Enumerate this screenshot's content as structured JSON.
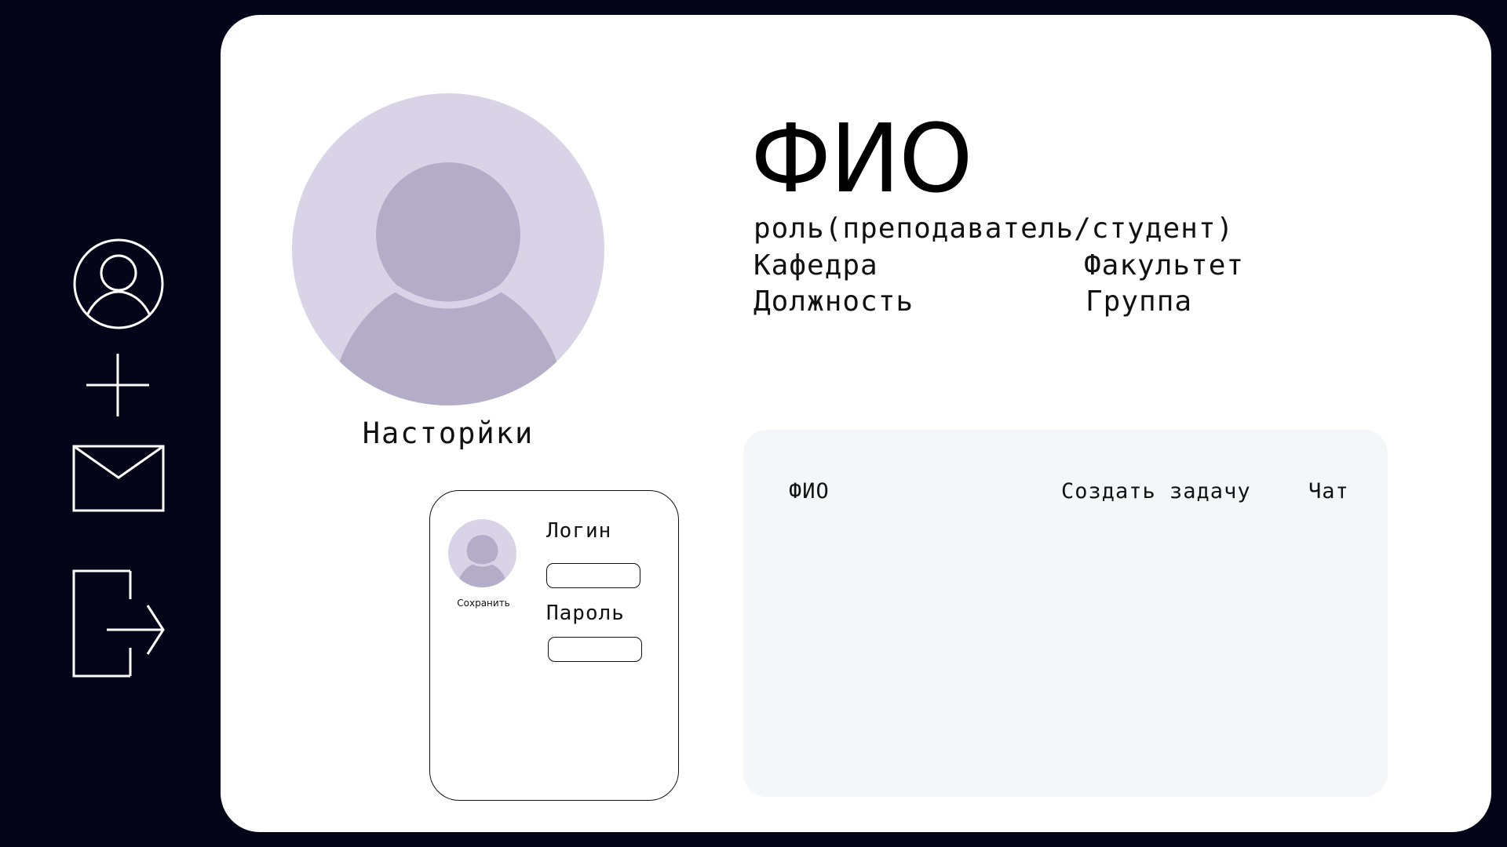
{
  "sidebar": {
    "items": [
      {
        "name": "profile",
        "icon": "user-circle-icon"
      },
      {
        "name": "add",
        "icon": "plus-icon"
      },
      {
        "name": "messages",
        "icon": "mail-icon"
      },
      {
        "name": "logout",
        "icon": "logout-icon"
      }
    ],
    "icon_color": "#ffffff"
  },
  "profile": {
    "name": "ФИО",
    "role": "роль(преподаватель/студент)",
    "department": "Кафедра",
    "faculty": "Факультет",
    "position": "Должность",
    "group": "Группа",
    "settings_label": "Насторйки",
    "avatar_icon": "avatar-placeholder-icon"
  },
  "settings_card": {
    "save_label": "Сохранить",
    "login_label": "Логин",
    "login_value": "",
    "password_label": "Пароль",
    "password_value": ""
  },
  "tasks": {
    "columns": [
      "ФИО",
      "Создать задачу",
      "Чат"
    ]
  },
  "colors": {
    "background": "#05051a",
    "panel": "#ffffff",
    "avatar_bg": "#d9d3e8",
    "avatar_fg": "#b3adc7",
    "tasks_panel": "#f5f6fa"
  }
}
